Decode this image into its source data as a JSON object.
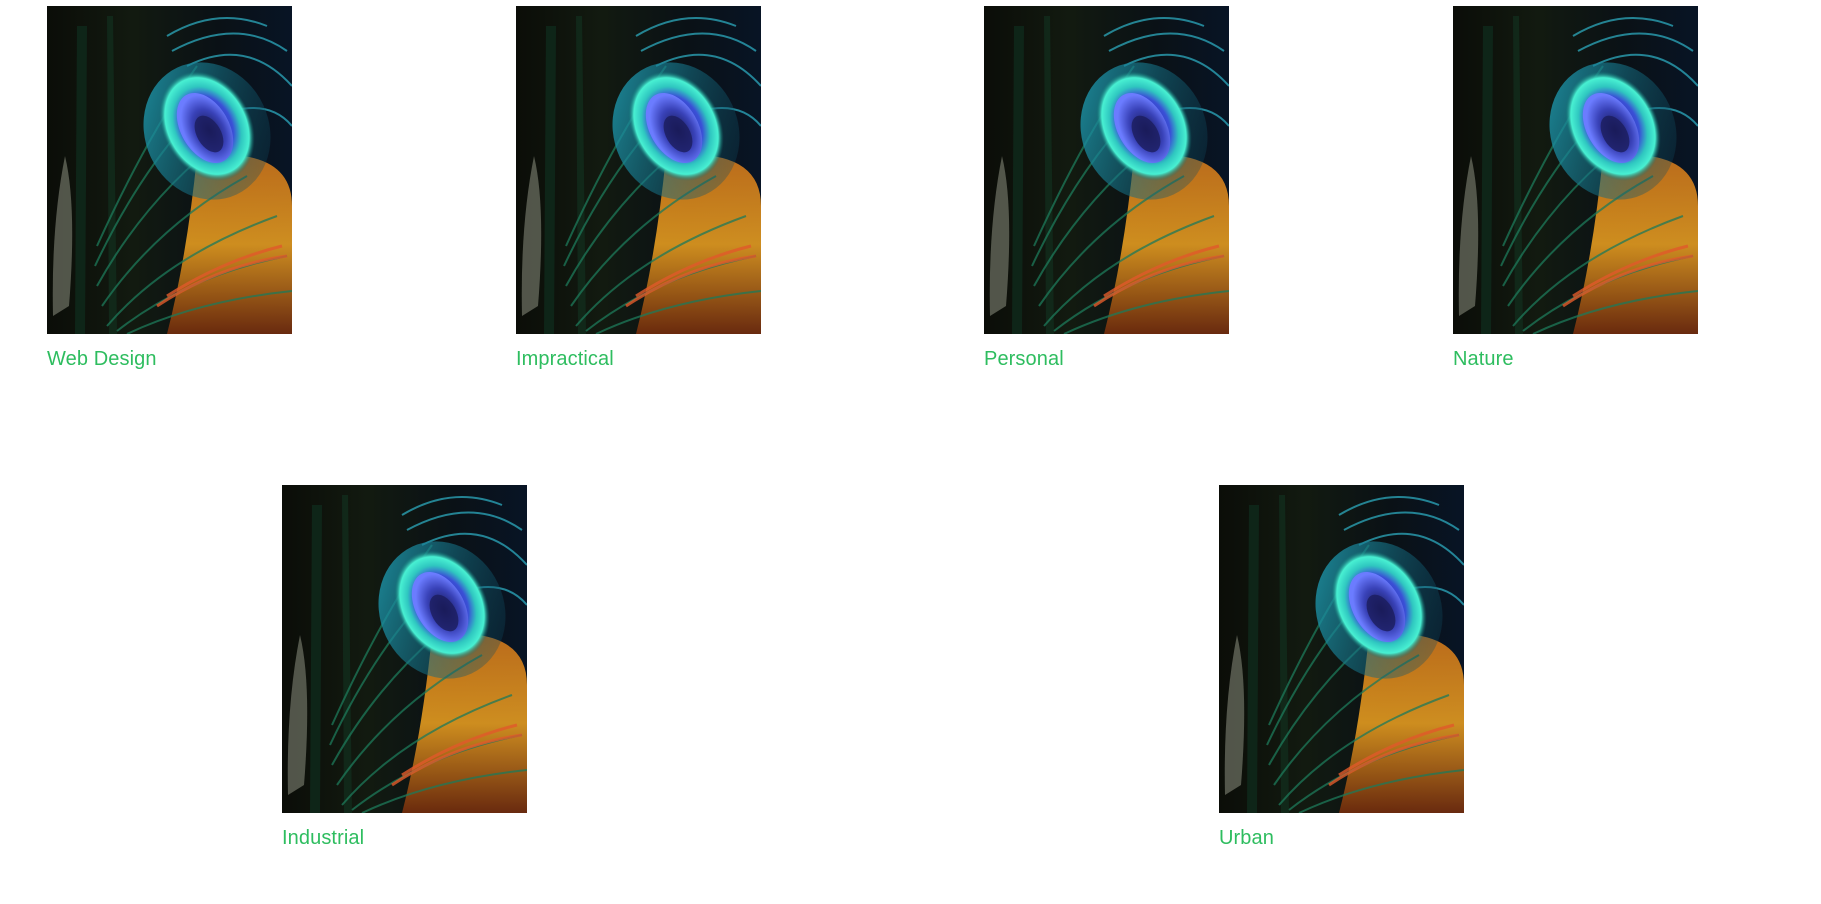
{
  "gallery": {
    "items": [
      {
        "label": "Web Design",
        "image": "peacock-feather-photo"
      },
      {
        "label": "Impractical",
        "image": "peacock-feather-photo"
      },
      {
        "label": "Personal",
        "image": "peacock-feather-photo"
      },
      {
        "label": "Nature",
        "image": "peacock-feather-photo"
      },
      {
        "label": "Industrial",
        "image": "peacock-feather-photo"
      },
      {
        "label": "Urban",
        "image": "peacock-feather-photo"
      }
    ],
    "caption_color": "#2ebd5f"
  }
}
